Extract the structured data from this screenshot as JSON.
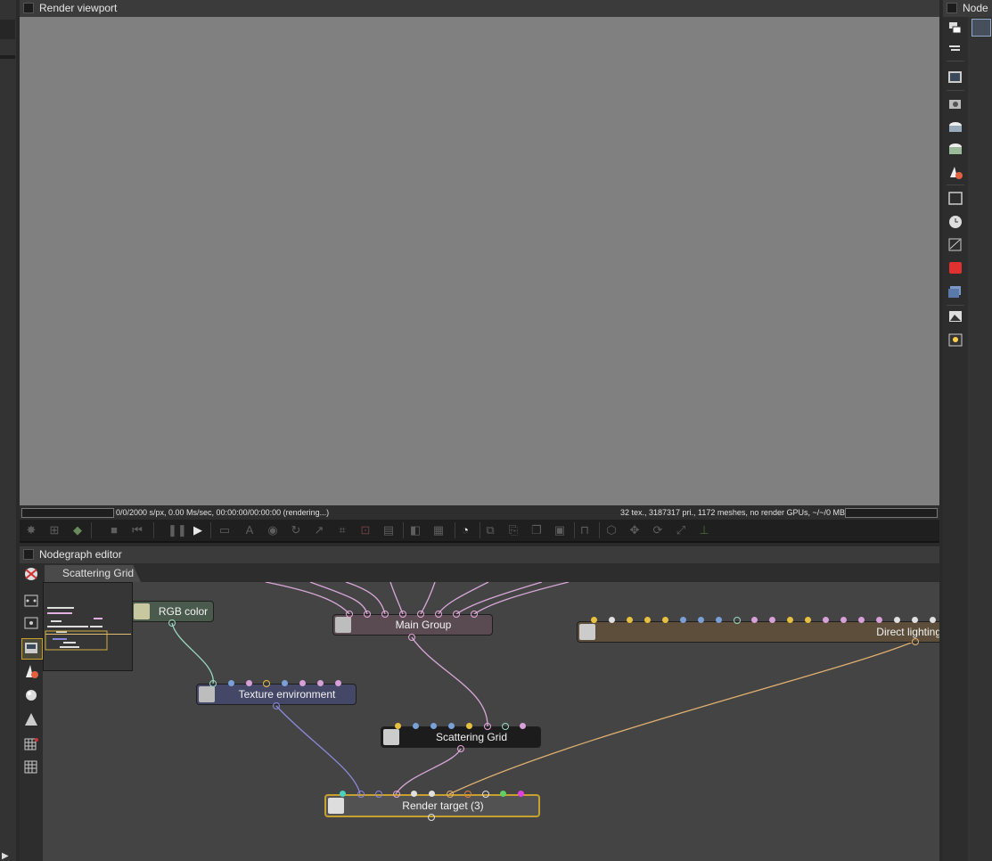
{
  "render_viewport": {
    "title": "Render viewport",
    "status_left": "0/0/2000 s/px, 0.00 Ms/sec, 00:00:00/00:00:00 (rendering...)",
    "status_right": "32 tex., 3187317 pri., 1172 meshes, no render GPUs, ~/~/0 MB"
  },
  "node_inspector": {
    "title": "Node in"
  },
  "nodegraph": {
    "title": "Nodegraph editor",
    "tab": "Scattering Grid",
    "nodes": {
      "rgb_color": "RGB color",
      "main_group": "Main Group",
      "direct_lighting": "Direct lighting",
      "texture_environment": "Texture environment",
      "scattering_grid": "Scattering Grid",
      "render_target": "Render target (3)"
    }
  },
  "colors": {
    "accent_selection": "#c8a030",
    "viewport_bg": "#808080",
    "graph_bg": "#444444"
  }
}
